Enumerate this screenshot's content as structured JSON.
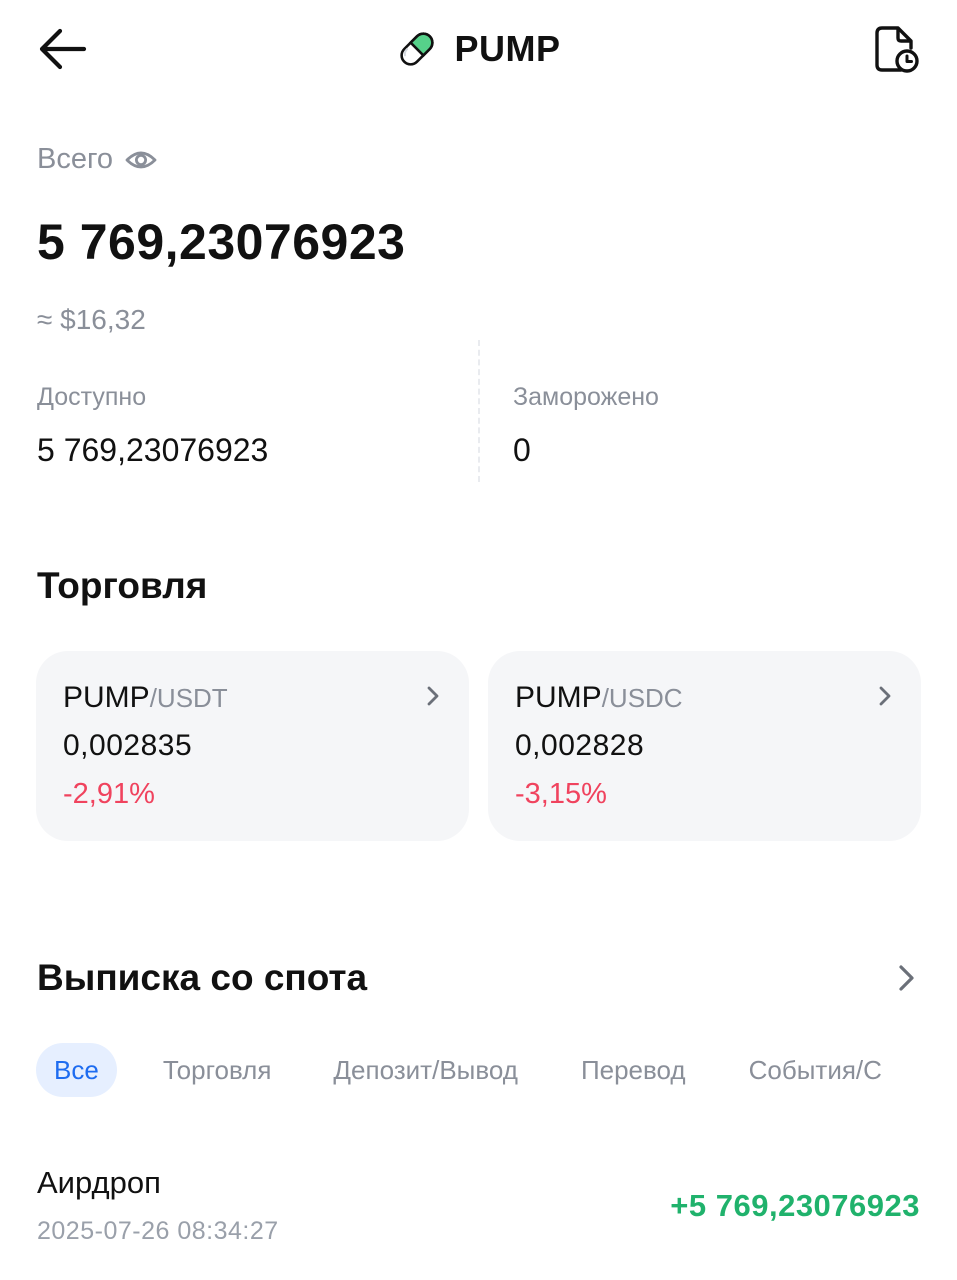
{
  "header": {
    "title": "PUMP",
    "coin_icon": "pill-icon",
    "back_icon": "arrow-left-icon",
    "history_icon": "document-clock-icon"
  },
  "balance": {
    "total_label": "Всего",
    "total_value": "5 769,23076923",
    "usd_value": "≈ $16,32",
    "available_label": "Доступно",
    "available_value": "5 769,23076923",
    "frozen_label": "Заморожено",
    "frozen_value": "0"
  },
  "trading": {
    "title": "Торговля",
    "pairs": [
      {
        "base": "PUMP",
        "quote": "/USDT",
        "price": "0,002835",
        "change": "-2,91%"
      },
      {
        "base": "PUMP",
        "quote": "/USDC",
        "price": "0,002828",
        "change": "-3,15%"
      }
    ]
  },
  "statement": {
    "title": "Выписка со спота",
    "tabs": [
      "Все",
      "Торговля",
      "Депозит/Вывод",
      "Перевод",
      "События/С"
    ],
    "active_tab": "Все",
    "transactions": [
      {
        "type": "Аирдроп",
        "date": "2025-07-26 08:34:27",
        "amount": "+5 769,23076923"
      }
    ]
  },
  "colors": {
    "negative": "#f0435e",
    "positive": "#20b26c",
    "accent": "#1e6cf0",
    "muted": "#8a8f99",
    "card_bg": "#f5f6f8"
  }
}
